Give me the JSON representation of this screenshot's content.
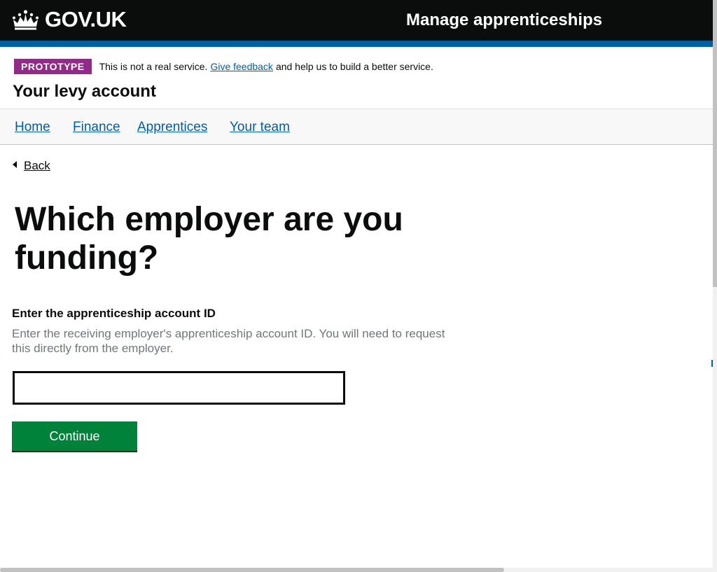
{
  "header": {
    "logo_text": "GOV.UK",
    "logo_icon": "crown-icon",
    "service_name": "Manage apprenticeships",
    "colors": {
      "header_bg": "#0b0c0c",
      "stripe": "#005ea5"
    }
  },
  "phase_banner": {
    "tag": "PROTOTYPE",
    "text_before": "This is not a real service.",
    "link_text": "Give feedback",
    "text_after": "and help us to build a better service.",
    "tag_color": "#912b88"
  },
  "account": {
    "title": "Your levy account"
  },
  "nav": {
    "items": [
      {
        "label": "Home"
      },
      {
        "label": "Finance"
      },
      {
        "label": "Apprentices"
      },
      {
        "label": "Your team"
      }
    ]
  },
  "back_link": {
    "label": "Back",
    "icon": "back-arrow-icon"
  },
  "main": {
    "heading": "Which employer are you funding?",
    "field_label": "Enter the apprenticeship account ID",
    "field_hint": "Enter the receiving employer's apprenticeship account ID. You will need to request this directly from the employer.",
    "input_value": "",
    "continue_label": "Continue",
    "button_color": "#00823b"
  }
}
